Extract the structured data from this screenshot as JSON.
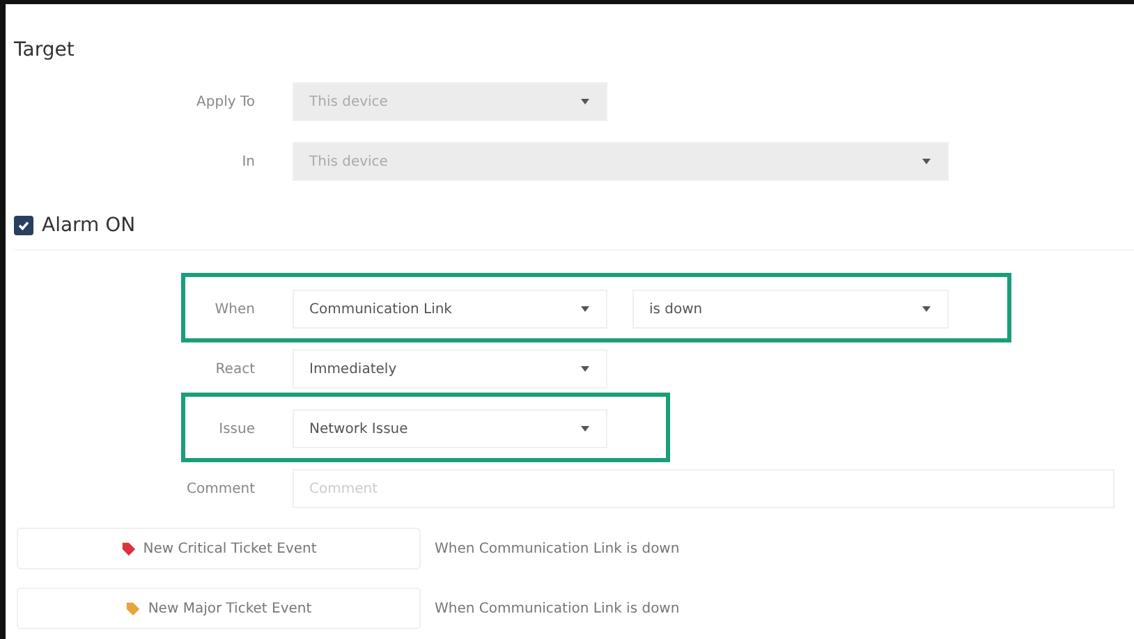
{
  "section": {
    "title": "Target"
  },
  "target_fields": [
    {
      "label": "Apply To",
      "kind": "short",
      "value": "This device",
      "disabled": true
    },
    {
      "label": "In",
      "kind": "wide",
      "value": "This device",
      "disabled": true
    }
  ],
  "alarm": {
    "label": "Alarm ON",
    "checked": true
  },
  "rule_fields": [
    {
      "label": "When",
      "kind": "select",
      "highlighted": true,
      "selects": [
        "Communication Link",
        "is down"
      ]
    },
    {
      "label": "React",
      "kind": "select",
      "highlighted": false,
      "selects": [
        "Immediately"
      ]
    },
    {
      "label": "Issue",
      "kind": "select",
      "highlighted": true,
      "selects": [
        "Network Issue"
      ]
    },
    {
      "label": "Comment",
      "kind": "text",
      "highlighted": false,
      "placeholder": "Comment"
    }
  ],
  "events": [
    {
      "label": "New Critical Ticket Event",
      "color": "#d9333f",
      "description": "When Communication Link is down"
    },
    {
      "label": "New Major Ticket Event",
      "color": "#e8a33a",
      "description": "When Communication Link is down"
    }
  ]
}
